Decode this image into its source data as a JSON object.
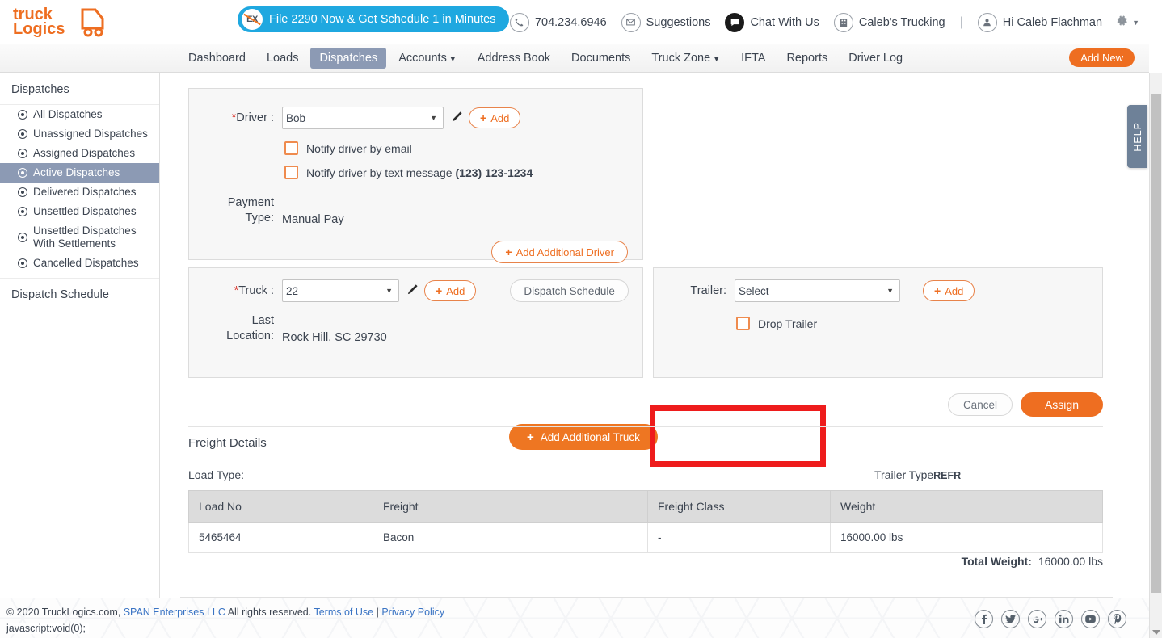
{
  "header": {
    "logo_line1": "truck",
    "logo_line2": "Logics",
    "promo_text": "File 2290 Now & Get Schedule 1 in Minutes",
    "promo_logo_text": "EX",
    "phone": "704.234.6946",
    "suggestions": "Suggestions",
    "chat": "Chat With Us",
    "company": "Caleb's Trucking",
    "separator": "|",
    "greeting": "Hi Caleb Flachman",
    "gear_icon": "gear-icon",
    "caret_icon": "chevron-down-icon"
  },
  "nav": {
    "items": [
      {
        "label": "Dashboard",
        "active": false,
        "caret": false
      },
      {
        "label": "Loads",
        "active": false,
        "caret": false
      },
      {
        "label": "Dispatches",
        "active": true,
        "caret": false
      },
      {
        "label": "Accounts",
        "active": false,
        "caret": true
      },
      {
        "label": "Address Book",
        "active": false,
        "caret": false
      },
      {
        "label": "Documents",
        "active": false,
        "caret": false
      },
      {
        "label": "Truck Zone",
        "active": false,
        "caret": true
      },
      {
        "label": "IFTA",
        "active": false,
        "caret": false
      },
      {
        "label": "Reports",
        "active": false,
        "caret": false
      },
      {
        "label": "Driver Log",
        "active": false,
        "caret": false
      }
    ],
    "add_new": "Add New"
  },
  "sidebar": {
    "heading": "Dispatches",
    "items": [
      {
        "label": "All Dispatches",
        "active": false
      },
      {
        "label": "Unassigned Dispatches",
        "active": false
      },
      {
        "label": "Assigned Dispatches",
        "active": false
      },
      {
        "label": "Active Dispatches",
        "active": true
      },
      {
        "label": "Delivered Dispatches",
        "active": false
      },
      {
        "label": "Unsettled Dispatches",
        "active": false
      },
      {
        "label": "Unsettled Dispatches With Settlements",
        "active": false
      },
      {
        "label": "Cancelled Dispatches",
        "active": false
      }
    ],
    "footer_item": "Dispatch Schedule"
  },
  "driver_section": {
    "label": "Driver :",
    "required_mark": "*",
    "selected": "Bob",
    "edit_icon": "pencil-icon",
    "add_label": "Add",
    "notify_email_label": "Notify driver by email",
    "notify_email_checked": false,
    "notify_text_label": "Notify driver by text message",
    "notify_text_phone": "(123) 123-1234",
    "notify_text_checked": false,
    "payment_type_label_1": "Payment",
    "payment_type_label_2": "Type:",
    "payment_type_value": "Manual Pay",
    "add_additional_driver": "Add Additional Driver"
  },
  "truck_section": {
    "label": "Truck :",
    "required_mark": "*",
    "selected": "22",
    "edit_icon": "pencil-icon",
    "add_label": "Add",
    "dispatch_schedule_label": "Dispatch Schedule",
    "last_location_label_1": "Last",
    "last_location_label_2": "Location:",
    "last_location_value": "Rock Hill, SC 29730",
    "add_additional_truck": "Add Additional Truck",
    "highlight_color": "#ee1c1c"
  },
  "trailer_section": {
    "label": "Trailer:",
    "selected": "Select",
    "add_label": "Add",
    "drop_trailer_label": "Drop Trailer",
    "drop_trailer_checked": false
  },
  "actions": {
    "cancel": "Cancel",
    "assign": "Assign"
  },
  "freight": {
    "title": "Freight Details",
    "load_type_label": "Load Type:",
    "load_type_value": "",
    "trailer_type_label": "Trailer Type",
    "trailer_type_value": "REFR",
    "columns": [
      "Load No",
      "Freight",
      "Freight Class",
      "Weight"
    ],
    "rows": [
      {
        "load_no": "5465464",
        "freight": "Bacon",
        "freight_class": "-",
        "weight": "16000.00 lbs"
      }
    ],
    "total_weight_label": "Total Weight:",
    "total_weight_value": "16000.00 lbs"
  },
  "help_tab": {
    "label": "HELP"
  },
  "footer": {
    "copyright_pre": "© 2020 TruckLogics.com, ",
    "span_link": "SPAN Enterprises LLC",
    "copyright_post": " All rights reserved. ",
    "terms": "Terms of Use",
    "pipe": " | ",
    "privacy": "Privacy Policy",
    "status_bar": "javascript:void(0);",
    "social": [
      "facebook-icon",
      "twitter-icon",
      "google-plus-icon",
      "linkedin-icon",
      "youtube-icon",
      "pinterest-icon"
    ]
  },
  "colors": {
    "brand_orange": "#ee6e21",
    "nav_active": "#8c9ab4",
    "promo_blue": "#1fa8e0",
    "highlight_red": "#ee1c1c",
    "link_blue": "#3a74c4"
  }
}
